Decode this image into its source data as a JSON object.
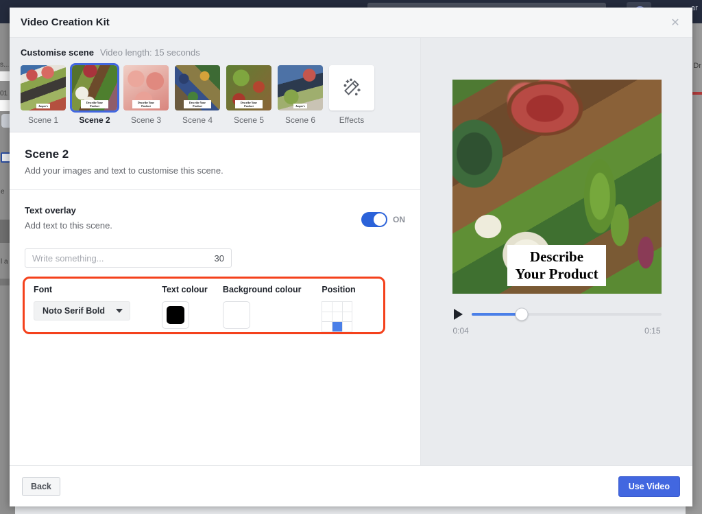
{
  "background": {
    "left_fragments": [
      "s...",
      "01",
      "e",
      "l a"
    ],
    "right_fragments": [
      "ar",
      "Dr"
    ]
  },
  "modal": {
    "title": "Video Creation Kit",
    "close_icon": "close-icon",
    "close_glyph": "✕"
  },
  "scene_strip": {
    "customise_label": "Customise scene",
    "video_length": "Video length: 15 seconds",
    "scenes": [
      {
        "label": "Scene 1",
        "thumb_class": "t1",
        "caption": "Jasper's",
        "selected": false
      },
      {
        "label": "Scene 2",
        "thumb_class": "t2",
        "caption": "Describe Your Product",
        "selected": true
      },
      {
        "label": "Scene 3",
        "thumb_class": "t3",
        "caption": "Describe Your Product",
        "selected": false
      },
      {
        "label": "Scene 4",
        "thumb_class": "t4",
        "caption": "Describe Your Product",
        "selected": false
      },
      {
        "label": "Scene 5",
        "thumb_class": "t5",
        "caption": "Describe Your Product",
        "selected": false
      },
      {
        "label": "Scene 6",
        "thumb_class": "t6",
        "caption": "Jasper's",
        "selected": false
      }
    ],
    "effects": {
      "label": "Effects",
      "icon": "magic-wand-icon"
    }
  },
  "scene_detail": {
    "title": "Scene 2",
    "subtitle": "Add your images and text to customise this scene."
  },
  "text_overlay": {
    "title": "Text overlay",
    "subtitle": "Add text to this scene.",
    "toggle_state": "ON",
    "input_value": "",
    "input_placeholder": "Write something...",
    "char_count": "30"
  },
  "controls": {
    "highlight_colour": "#f4411c",
    "font": {
      "label": "Font",
      "value": "Noto Serif Bold",
      "caret_icon": "chevron-down-icon"
    },
    "text_colour": {
      "label": "Text colour",
      "value": "#000000"
    },
    "background_colour": {
      "label": "Background colour",
      "value": "#ffffff"
    },
    "position": {
      "label": "Position",
      "selected_cell": 7,
      "cells": [
        0,
        1,
        2,
        3,
        4,
        5,
        6,
        7,
        8
      ],
      "active_colour": "#4a7fe8"
    }
  },
  "preview": {
    "caption_text": "Describe Your Product",
    "play_icon": "play-icon",
    "progress_percent": 26.7,
    "current_time": "0:04",
    "total_time": "0:15",
    "accent_colour": "#4a7fe8"
  },
  "footer": {
    "back_label": "Back",
    "use_video_label": "Use Video",
    "primary_colour": "#4267e0"
  }
}
